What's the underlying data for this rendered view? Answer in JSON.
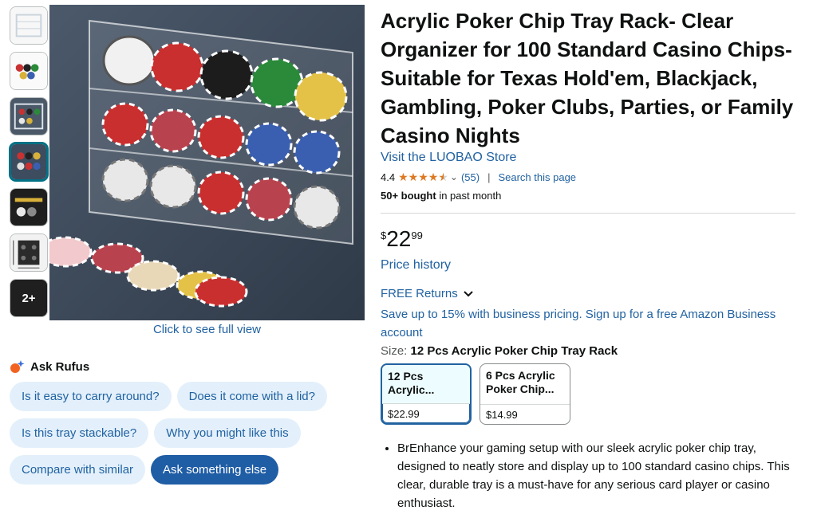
{
  "gallery": {
    "thumbnails": [
      {
        "icon": "chip-tray-white-thumbnail"
      },
      {
        "icon": "chip-tray-colored-thumbnail"
      },
      {
        "icon": "chip-tray-stacked-thumbnail"
      },
      {
        "icon": "chip-tray-main-thumbnail",
        "selected": true
      },
      {
        "icon": "chip-tray-dark-thumbnail"
      },
      {
        "icon": "chip-tray-dimensions-thumbnail"
      }
    ],
    "more_label": "2+",
    "full_view_label": "Click to see full view",
    "share_icon": "share-icon"
  },
  "rufus": {
    "title": "Ask Rufus",
    "chips": [
      [
        "Is it easy to carry around?",
        "Does it come with a lid?"
      ],
      [
        "Is this tray stackable?",
        "Why you might like this"
      ],
      [
        "Compare with similar",
        "Ask something else"
      ]
    ]
  },
  "product": {
    "title": "Acrylic Poker Chip Tray Rack- Clear Organizer for 100 Standard Casino Chips- Suitable for Texas Hold'em, Blackjack, Gambling, Poker Clubs, Parties, or Family Casino Nights",
    "store_link": "Visit the LUOBAO Store",
    "rating": "4.4",
    "rating_value": 4.4,
    "rating_count": "(55)",
    "search_page": "Search this page",
    "bought_bold": "50+ bought",
    "bought_rest": " in past month",
    "price_symbol": "$",
    "price_whole": "22",
    "price_fraction": "99",
    "price_history": "Price history",
    "returns": "FREE Returns",
    "business": "Save up to 15% with business pricing. Sign up for a free Amazon Business account",
    "size_label": "Size:",
    "size_value": "12 Pcs Acrylic Poker Chip Tray Rack",
    "swatches": [
      {
        "label": "12 Pcs Acrylic...",
        "price": "$22.99",
        "selected": true
      },
      {
        "label": "6 Pcs Acrylic Poker Chip...",
        "price": "$14.99",
        "selected": false
      }
    ],
    "bullets": [
      "BrEnhance your gaming setup with our sleek acrylic poker chip tray, designed to neatly store and display up to 100 standard casino chips. This clear, durable tray is a must-have for any serious card player or casino enthusiast."
    ]
  },
  "colors": {
    "link": "#2162a1",
    "star": "#de7921",
    "chip_bg": "#e3f0fb",
    "chip_primary": "#1f5da5"
  }
}
